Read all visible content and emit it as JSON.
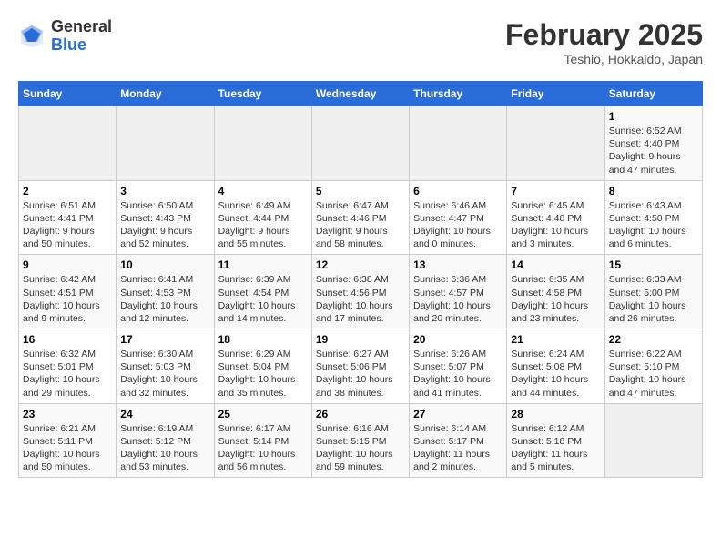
{
  "logo": {
    "text_general": "General",
    "text_blue": "Blue"
  },
  "header": {
    "month": "February 2025",
    "location": "Teshio, Hokkaido, Japan"
  },
  "weekdays": [
    "Sunday",
    "Monday",
    "Tuesday",
    "Wednesday",
    "Thursday",
    "Friday",
    "Saturday"
  ],
  "weeks": [
    [
      {
        "day": "",
        "info": ""
      },
      {
        "day": "",
        "info": ""
      },
      {
        "day": "",
        "info": ""
      },
      {
        "day": "",
        "info": ""
      },
      {
        "day": "",
        "info": ""
      },
      {
        "day": "",
        "info": ""
      },
      {
        "day": "1",
        "info": "Sunrise: 6:52 AM\nSunset: 4:40 PM\nDaylight: 9 hours and 47 minutes."
      }
    ],
    [
      {
        "day": "2",
        "info": "Sunrise: 6:51 AM\nSunset: 4:41 PM\nDaylight: 9 hours and 50 minutes."
      },
      {
        "day": "3",
        "info": "Sunrise: 6:50 AM\nSunset: 4:43 PM\nDaylight: 9 hours and 52 minutes."
      },
      {
        "day": "4",
        "info": "Sunrise: 6:49 AM\nSunset: 4:44 PM\nDaylight: 9 hours and 55 minutes."
      },
      {
        "day": "5",
        "info": "Sunrise: 6:47 AM\nSunset: 4:46 PM\nDaylight: 9 hours and 58 minutes."
      },
      {
        "day": "6",
        "info": "Sunrise: 6:46 AM\nSunset: 4:47 PM\nDaylight: 10 hours and 0 minutes."
      },
      {
        "day": "7",
        "info": "Sunrise: 6:45 AM\nSunset: 4:48 PM\nDaylight: 10 hours and 3 minutes."
      },
      {
        "day": "8",
        "info": "Sunrise: 6:43 AM\nSunset: 4:50 PM\nDaylight: 10 hours and 6 minutes."
      }
    ],
    [
      {
        "day": "9",
        "info": "Sunrise: 6:42 AM\nSunset: 4:51 PM\nDaylight: 10 hours and 9 minutes."
      },
      {
        "day": "10",
        "info": "Sunrise: 6:41 AM\nSunset: 4:53 PM\nDaylight: 10 hours and 12 minutes."
      },
      {
        "day": "11",
        "info": "Sunrise: 6:39 AM\nSunset: 4:54 PM\nDaylight: 10 hours and 14 minutes."
      },
      {
        "day": "12",
        "info": "Sunrise: 6:38 AM\nSunset: 4:56 PM\nDaylight: 10 hours and 17 minutes."
      },
      {
        "day": "13",
        "info": "Sunrise: 6:36 AM\nSunset: 4:57 PM\nDaylight: 10 hours and 20 minutes."
      },
      {
        "day": "14",
        "info": "Sunrise: 6:35 AM\nSunset: 4:58 PM\nDaylight: 10 hours and 23 minutes."
      },
      {
        "day": "15",
        "info": "Sunrise: 6:33 AM\nSunset: 5:00 PM\nDaylight: 10 hours and 26 minutes."
      }
    ],
    [
      {
        "day": "16",
        "info": "Sunrise: 6:32 AM\nSunset: 5:01 PM\nDaylight: 10 hours and 29 minutes."
      },
      {
        "day": "17",
        "info": "Sunrise: 6:30 AM\nSunset: 5:03 PM\nDaylight: 10 hours and 32 minutes."
      },
      {
        "day": "18",
        "info": "Sunrise: 6:29 AM\nSunset: 5:04 PM\nDaylight: 10 hours and 35 minutes."
      },
      {
        "day": "19",
        "info": "Sunrise: 6:27 AM\nSunset: 5:06 PM\nDaylight: 10 hours and 38 minutes."
      },
      {
        "day": "20",
        "info": "Sunrise: 6:26 AM\nSunset: 5:07 PM\nDaylight: 10 hours and 41 minutes."
      },
      {
        "day": "21",
        "info": "Sunrise: 6:24 AM\nSunset: 5:08 PM\nDaylight: 10 hours and 44 minutes."
      },
      {
        "day": "22",
        "info": "Sunrise: 6:22 AM\nSunset: 5:10 PM\nDaylight: 10 hours and 47 minutes."
      }
    ],
    [
      {
        "day": "23",
        "info": "Sunrise: 6:21 AM\nSunset: 5:11 PM\nDaylight: 10 hours and 50 minutes."
      },
      {
        "day": "24",
        "info": "Sunrise: 6:19 AM\nSunset: 5:12 PM\nDaylight: 10 hours and 53 minutes."
      },
      {
        "day": "25",
        "info": "Sunrise: 6:17 AM\nSunset: 5:14 PM\nDaylight: 10 hours and 56 minutes."
      },
      {
        "day": "26",
        "info": "Sunrise: 6:16 AM\nSunset: 5:15 PM\nDaylight: 10 hours and 59 minutes."
      },
      {
        "day": "27",
        "info": "Sunrise: 6:14 AM\nSunset: 5:17 PM\nDaylight: 11 hours and 2 minutes."
      },
      {
        "day": "28",
        "info": "Sunrise: 6:12 AM\nSunset: 5:18 PM\nDaylight: 11 hours and 5 minutes."
      },
      {
        "day": "",
        "info": ""
      }
    ]
  ]
}
